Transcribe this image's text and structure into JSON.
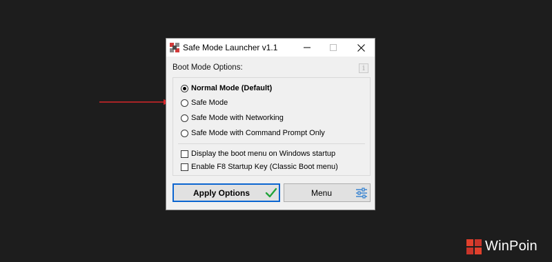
{
  "window": {
    "title": "Safe Mode Launcher v1.1",
    "section_label": "Boot Mode Options:",
    "info_icon_glyph": "i",
    "boot_modes": [
      {
        "label": "Normal Mode (Default)",
        "selected": true
      },
      {
        "label": "Safe Mode",
        "selected": false
      },
      {
        "label": "Safe Mode with Networking",
        "selected": false
      },
      {
        "label": "Safe Mode with Command Prompt Only",
        "selected": false
      }
    ],
    "boot_checkboxes": [
      {
        "label": "Display the boot menu on Windows startup",
        "checked": false
      },
      {
        "label": "Enable F8 Startup Key (Classic Boot menu)",
        "checked": false
      }
    ],
    "apply_button_label": "Apply Options",
    "menu_button_label": "Menu"
  },
  "watermark": {
    "text": "WinPoin"
  },
  "colors": {
    "background": "#1d1d1d",
    "arrow": "#d9262a",
    "apply_border": "#0a64d0",
    "check_green": "#21a33a",
    "slider_blue": "#2f7fd0"
  }
}
